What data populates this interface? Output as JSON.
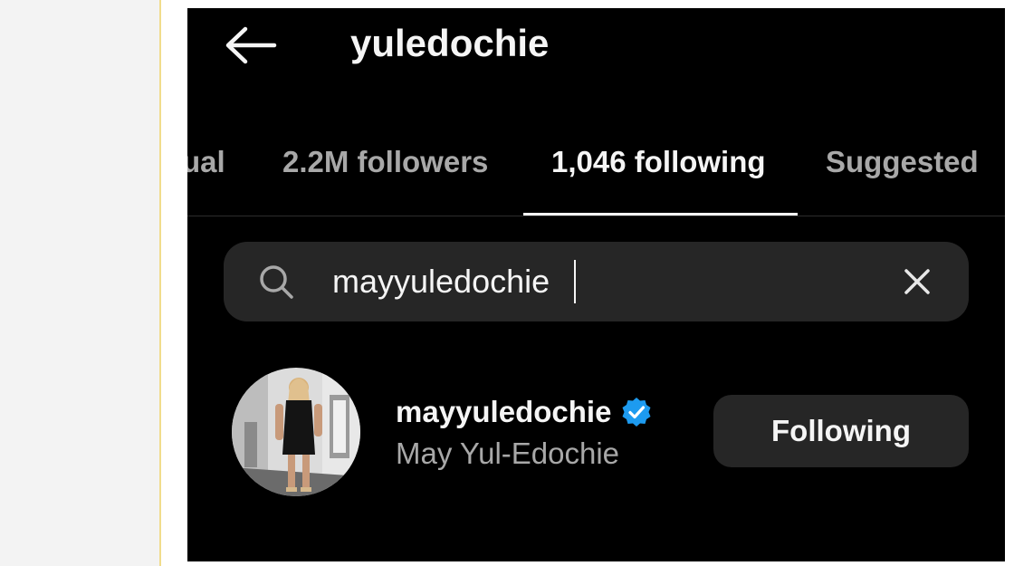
{
  "header": {
    "title": "yuledochie",
    "back_icon": "arrow-left-icon"
  },
  "tabs": [
    {
      "label": "ual"
    },
    {
      "label": "2.2M followers"
    },
    {
      "label": "1,046 following",
      "active": true
    },
    {
      "label": "Suggested"
    }
  ],
  "search": {
    "value": "mayyuledochie",
    "search_icon": "search-icon",
    "clear_icon": "close-icon"
  },
  "result": {
    "username": "mayyuledochie",
    "verified": true,
    "full_name": "May Yul-Edochie",
    "action_label": "Following"
  },
  "colors": {
    "background": "#000000",
    "surface": "#262626",
    "primary_text": "#f5f5f5",
    "secondary_text": "#a8a8a8",
    "verified_badge": "#1d9bf0"
  }
}
